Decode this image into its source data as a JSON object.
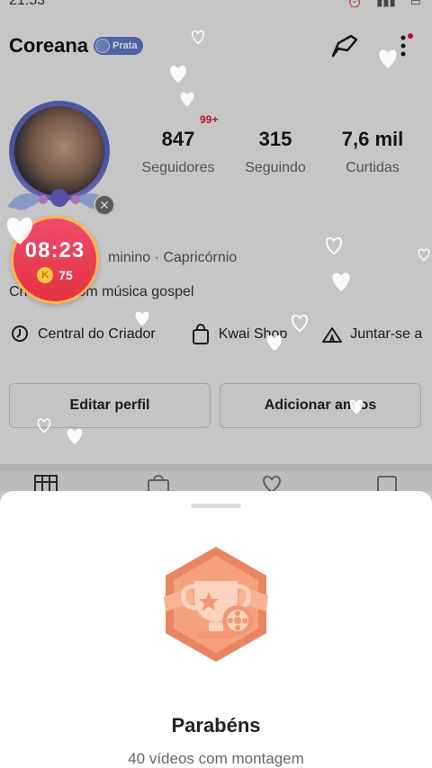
{
  "status_bar": {
    "time": "21:53"
  },
  "profile": {
    "username": "Coreana",
    "tier_badge": "Prata",
    "likes_new_badge": "99+",
    "stats": [
      {
        "value": "847",
        "label": "Seguidores"
      },
      {
        "value": "315",
        "label": "Seguindo"
      },
      {
        "value": "7,6 mil",
        "label": "Curtidas"
      }
    ],
    "info_line": "minino · Capricórnio",
    "bio": "Cri    vídeo com música gospel",
    "quick_links": [
      {
        "icon": "location-icon",
        "label": "Central do Criador"
      },
      {
        "icon": "shopping-bag-icon",
        "label": "Kwai Shop"
      },
      {
        "icon": "tent-icon",
        "label": "Juntar-se a"
      }
    ],
    "buttons": {
      "edit": "Editar perfil",
      "add_friends": "Adicionar am   os"
    }
  },
  "timer_widget": {
    "time": "08:23",
    "coin_symbol": "K",
    "coins": "75"
  },
  "sheet": {
    "title": "Parabéns",
    "subtitle": "40 vídeos com montagem"
  },
  "colors": {
    "accent_red": "#e3333f",
    "timer_ring": "#ffb64a",
    "badge_blue": "#5f7ccc",
    "medal_orange": "#e98563"
  }
}
